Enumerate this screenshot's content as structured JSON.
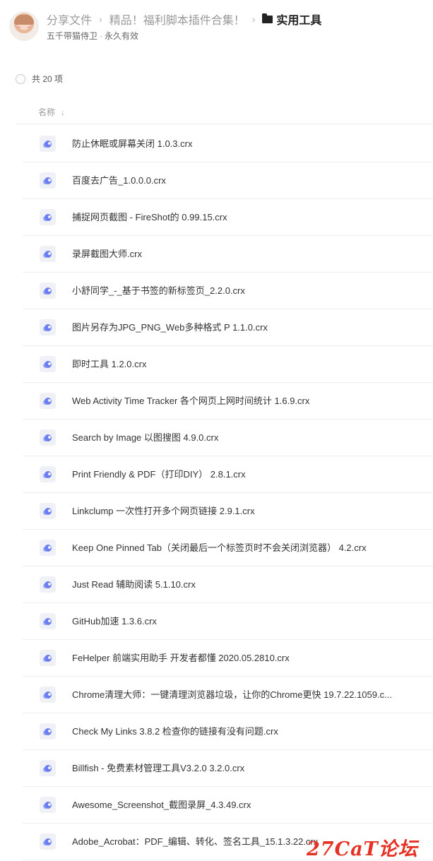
{
  "breadcrumb": {
    "items": [
      "分享文件",
      "精品！福利脚本插件合集！"
    ],
    "separator": "›",
    "current": "实用工具"
  },
  "share_info": {
    "owner": "五千带猫侍卫",
    "validity": "永久有效"
  },
  "list_summary": {
    "count_text": "共 20 项"
  },
  "columns": {
    "name_label": "名称",
    "sort_icon": "↓"
  },
  "files": [
    {
      "name": "防止休眠或屏幕关闭 1.0.3.crx"
    },
    {
      "name": "百度去广告_1.0.0.0.crx"
    },
    {
      "name": "捕捉网页截图 - FireShot的 0.99.15.crx"
    },
    {
      "name": "录屏截图大师.crx"
    },
    {
      "name": "小舒同学_-_基于书签的新标签页_2.2.0.crx"
    },
    {
      "name": "图片另存为JPG_PNG_Web多种格式 P 1.1.0.crx"
    },
    {
      "name": "即时工具 1.2.0.crx"
    },
    {
      "name": "Web Activity Time Tracker 各个网页上网时间统计 1.6.9.crx"
    },
    {
      "name": "Search by Image 以图搜图 4.9.0.crx"
    },
    {
      "name": "Print Friendly & PDF（打印DIY） 2.8.1.crx"
    },
    {
      "name": "Linkclump 一次性打开多个网页链接 2.9.1.crx"
    },
    {
      "name": "Keep One Pinned Tab（关闭最后一个标签页时不会关闭浏览器） 4.2.crx"
    },
    {
      "name": "Just Read 辅助阅读 5.1.10.crx"
    },
    {
      "name": "GitHub加速 1.3.6.crx"
    },
    {
      "name": "FeHelper 前端实用助手 开发者都懂 2020.05.2810.crx"
    },
    {
      "name": "Chrome清理大师：一键清理浏览器垃圾，让你的Chrome更快 19.7.22.1059.c..."
    },
    {
      "name": "Check My Links 3.8.2 检查你的链接有没有问题.crx"
    },
    {
      "name": "Billfish - 免费素材管理工具V3.2.0 3.2.0.crx"
    },
    {
      "name": "Awesome_Screenshot_截图录屏_4.3.49.crx"
    },
    {
      "name": "Adobe_Acrobat：PDF_编辑、转化、签名工具_15.1.3.22.crx"
    }
  ],
  "file_icon": "crx-extension-icon",
  "watermark": "27CaT论坛",
  "colors": {
    "file_icon_accent": "#6b7ef0",
    "watermark": "#e63224",
    "muted_text": "#9a9a9a"
  }
}
